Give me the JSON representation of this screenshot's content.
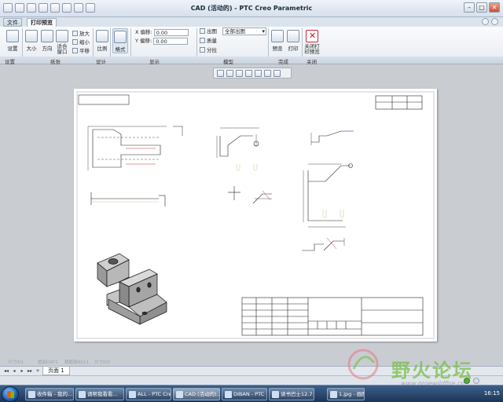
{
  "window": {
    "title": "CAD (活动的) - PTC Creo Parametric"
  },
  "tabs": {
    "file": "文件",
    "active": "打印预览"
  },
  "ribbon": {
    "settings": "设置",
    "size": "大小",
    "direction": "方向",
    "fit": "适合窗口",
    "zoom_in": "放大",
    "zoom_out": "缩小",
    "pan": "平移",
    "scale": "比例",
    "format": "格式",
    "offset_x_label": "X 偏移:",
    "offset_x_value": "0.00",
    "offset_y_label": "Y 偏移:",
    "offset_y_value": "0.00",
    "output_label": "出图",
    "output_value": "全部出图",
    "quality": "质量",
    "tile": "分拉",
    "preview": "预览",
    "print": "打印",
    "close_preview": "关闭打印预览",
    "groups": {
      "settings": "设置",
      "paper": "纸张",
      "design": "设计",
      "display": "显示",
      "model": "模型",
      "finish": "完成",
      "close": "关闭"
    }
  },
  "page_tab": "页面 1",
  "dim_labels": [
    "尺寸ID1",
    "框架DRF1",
    "横截面BDL1",
    "尺寸ID2"
  ],
  "taskbar": {
    "tasks": [
      "收件箱 - 我的...",
      "请帮我看看...",
      "ALL - PTC Cre...",
      "CAD (活动的)...",
      "DIBAN - PTC ...",
      "读书巴士12.7",
      "1.jpg - 画图"
    ],
    "clock": "16:15"
  },
  "watermark": {
    "text": "野火论坛",
    "url": "www.proewildfire.cn"
  }
}
